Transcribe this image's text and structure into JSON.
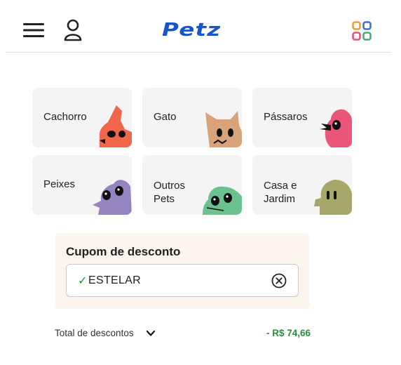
{
  "header": {
    "menu_icon": "hamburger-menu-icon",
    "user_icon": "user-icon",
    "logo_text": "Petz",
    "apps_icon": "app-grid-icon",
    "brand_color": "#1556c8"
  },
  "categories": [
    {
      "label": "Cachorro",
      "icon": "dog-icon",
      "color": "#f0664a"
    },
    {
      "label": "Gato",
      "icon": "cat-icon",
      "color": "#d8a37a"
    },
    {
      "label": "Pássaros",
      "icon": "bird-icon",
      "color": "#e9567a"
    },
    {
      "label": "Peixes",
      "icon": "fish-icon",
      "color": "#9683c2"
    },
    {
      "label": "Outros Pets",
      "icon": "reptile-icon",
      "color": "#6cc28e"
    },
    {
      "label": "Casa e Jardim",
      "icon": "house-garden-icon",
      "color": "#a7a76a"
    }
  ],
  "coupon": {
    "title": "Cupom de desconto",
    "check": "✓",
    "value": "ESTELAR",
    "clear_icon": "clear-circle-icon",
    "background": "#fbf5ee"
  },
  "totals": {
    "label": "Total de descontos",
    "chevron_icon": "chevron-down-icon",
    "value": "- R$ 74,66",
    "value_color": "#2e8b3a"
  }
}
